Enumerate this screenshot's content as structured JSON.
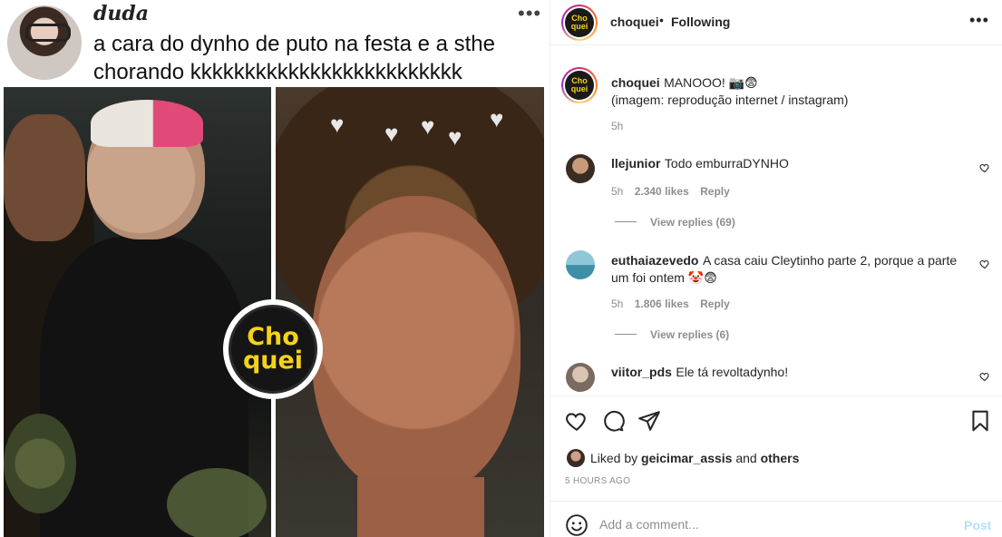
{
  "meme": {
    "author": "duda",
    "caption": "a cara do dynho de puto na festa e a sthe chorando kkkkkkkkkkkkkkkkkkkkkkkkk",
    "more_icon": "more-horizontal-icon",
    "watermark_line1": "Cho",
    "watermark_line2": "quei"
  },
  "header": {
    "username": "choquei",
    "separator": "•",
    "follow_status": "Following",
    "more_icon": "more-horizontal-icon"
  },
  "caption": {
    "username": "choquei",
    "text": "MANOOO! 📷😨",
    "subtext": "(imagem: reprodução internet / instagram)",
    "age": "5h"
  },
  "comments": [
    {
      "username": "llejunior",
      "text": "Todo emburraDYNHO",
      "age": "5h",
      "likes": "2.340 likes",
      "reply": "Reply",
      "view_replies": "View replies (69)"
    },
    {
      "username": "euthaiazevedo",
      "text": "A casa caiu Cleytinho parte 2, porque a parte",
      "text2": "um foi ontem 🤡😨",
      "age": "5h",
      "likes": "1.806 likes",
      "reply": "Reply",
      "view_replies": "View replies (6)"
    },
    {
      "username": "viitor_pds",
      "text": "Ele tá revoltadynho!"
    }
  ],
  "actions": {
    "like_icon": "heart-icon",
    "comment_icon": "comment-icon",
    "share_icon": "paper-plane-icon",
    "save_icon": "bookmark-icon",
    "liked_by_prefix": "Liked by",
    "liked_by_user": "geicimar_assis",
    "liked_by_and": "and",
    "liked_by_others": "others",
    "timestamp": "5 HOURS AGO"
  },
  "composer": {
    "emoji_icon": "smiley-icon",
    "placeholder": "Add a comment...",
    "post_label": "Post"
  },
  "colors": {
    "brand_yellow": "#f5d21a",
    "link_disabled": "#b2dffc",
    "secondary_text": "#8e8e8e"
  }
}
